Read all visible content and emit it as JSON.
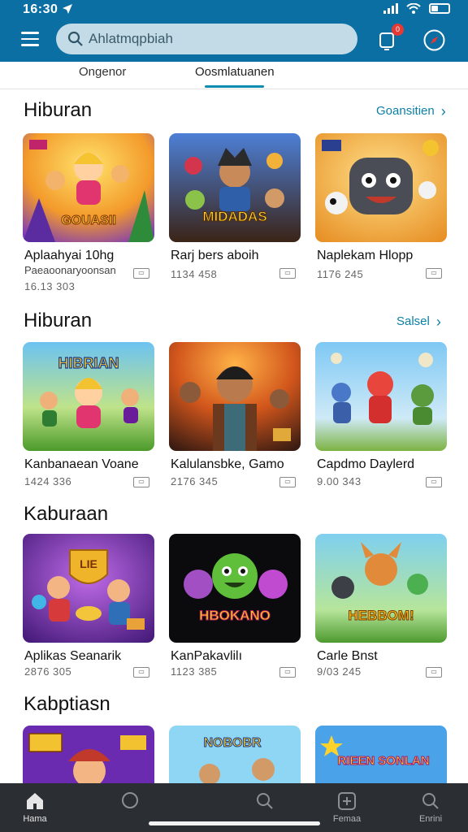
{
  "status_bar": {
    "time": "16:30"
  },
  "search": {
    "placeholder": "Ahlatmqpbiah"
  },
  "notifications": {
    "count": "0"
  },
  "tabs": [
    {
      "label": "Ongenor",
      "active": false
    },
    {
      "label": "Oosmlatuanen",
      "active": true
    }
  ],
  "sections": [
    {
      "title": "Hiburan",
      "see_all": "Goansitien",
      "cards": [
        {
          "title": "Aplaahyai 10hg",
          "subtitle": "Paeaoonaryoonsan",
          "stat": "16.13   303",
          "art": "GOUASII"
        },
        {
          "title": "Rarj bers aboih",
          "subtitle": "",
          "stat": "1134   458",
          "art": "MIDADAS"
        },
        {
          "title": "Naplekam Hlopp",
          "subtitle": "",
          "stat": "1176   245",
          "art": ""
        }
      ]
    },
    {
      "title": "Hiburan",
      "see_all": "Salsel",
      "cards": [
        {
          "title": "Kanbanaean Voane",
          "subtitle": "",
          "stat": "1424   336",
          "art": "HIBRIAN"
        },
        {
          "title": "Kalulansbke, Gamo",
          "subtitle": "",
          "stat": "2176   345",
          "art": ""
        },
        {
          "title": "Capdmo Daylerd",
          "subtitle": "",
          "stat": "9.00   343",
          "art": ""
        }
      ]
    },
    {
      "title": "Kaburaan",
      "see_all": "",
      "cards": [
        {
          "title": "Aplikas Seanarik",
          "subtitle": "",
          "stat": "2876   305",
          "art": "LIE"
        },
        {
          "title": "KanPakavlilı",
          "subtitle": "",
          "stat": "1123   385",
          "art": "HBOKANO"
        },
        {
          "title": "Carle Bnst",
          "subtitle": "",
          "stat": "9/03   245",
          "art": "HEBBOM!"
        }
      ]
    },
    {
      "title": "Kabptiasn",
      "see_all": "",
      "cards": [
        {
          "art": ""
        },
        {
          "art": "NOBOBR"
        },
        {
          "art": "RIEEN SONLAN"
        }
      ]
    }
  ],
  "bottom_nav": [
    {
      "label": "Hama",
      "icon": "home-icon"
    },
    {
      "label": "",
      "icon": "chat-icon"
    },
    {
      "label": "",
      "icon": "search-icon"
    },
    {
      "label": "Femaa",
      "icon": "add-icon"
    },
    {
      "label": "Enrini",
      "icon": "search-icon"
    }
  ],
  "colors": {
    "header": "#0b6fa4",
    "accent": "#0b8cb0",
    "nav_bg": "#2b2f33"
  }
}
